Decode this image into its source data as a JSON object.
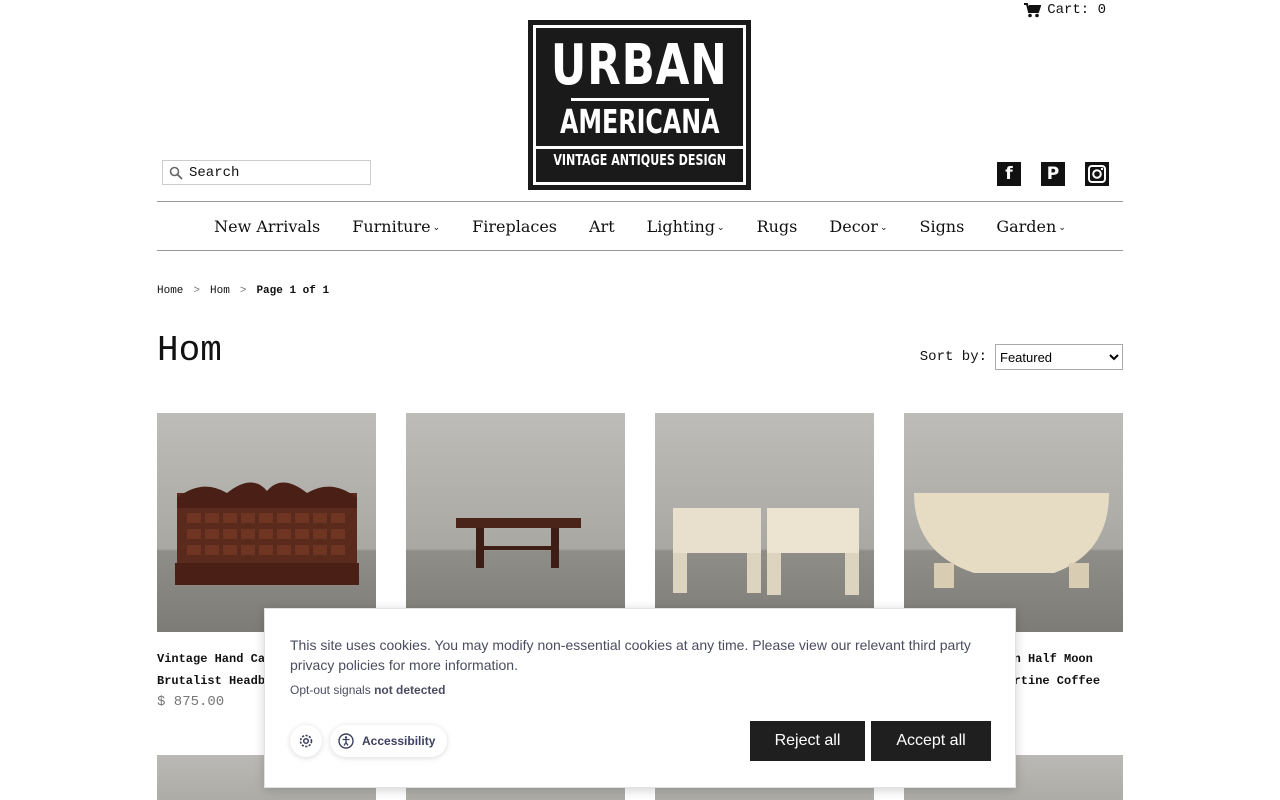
{
  "header": {
    "cart_label": "Cart: 0",
    "logo": {
      "line1": "URBAN",
      "line2": "AMERICANA",
      "line3": "VINTAGE ANTIQUES DESIGN"
    },
    "search_placeholder": "Search",
    "social": [
      "facebook",
      "pinterest",
      "instagram"
    ]
  },
  "nav": {
    "items": [
      {
        "label": "New Arrivals",
        "dropdown": false
      },
      {
        "label": "Furniture",
        "dropdown": true
      },
      {
        "label": "Fireplaces",
        "dropdown": false
      },
      {
        "label": "Art",
        "dropdown": false
      },
      {
        "label": "Lighting",
        "dropdown": true
      },
      {
        "label": "Rugs",
        "dropdown": false
      },
      {
        "label": "Decor",
        "dropdown": true
      },
      {
        "label": "Signs",
        "dropdown": false
      },
      {
        "label": "Garden",
        "dropdown": true
      }
    ]
  },
  "breadcrumb": {
    "home": "Home",
    "section": "Hom",
    "current": "Page 1 of 1",
    "separator": ">"
  },
  "page": {
    "title": "Hom",
    "sort_label": "Sort by:",
    "sort_selected": "Featured"
  },
  "products": [
    {
      "name_line1": "Vintage Hand Ca",
      "name_line2": "Brutalist Headb",
      "price": "$ 875.00"
    },
    {
      "name_line1": "",
      "name_line2": "",
      "price": ""
    },
    {
      "name_line1": "",
      "name_line2": "",
      "price": ""
    },
    {
      "name_line1": "dern Half Moon",
      "name_line2": "avertine Coffee",
      "price": ""
    }
  ],
  "cookie": {
    "message": "This site uses cookies. You may modify non-essential cookies at any time. Please view our relevant third party privacy policies for more information.",
    "opt_out_prefix": "Opt-out signals",
    "opt_out_status": "not detected",
    "accessibility_label": "Accessibility",
    "reject_label": "Reject all",
    "accept_label": "Accept all"
  },
  "colors": {
    "button_dark": "#1f1f1f",
    "cookie_text": "#4a4d60",
    "price_gray": "#777777"
  }
}
